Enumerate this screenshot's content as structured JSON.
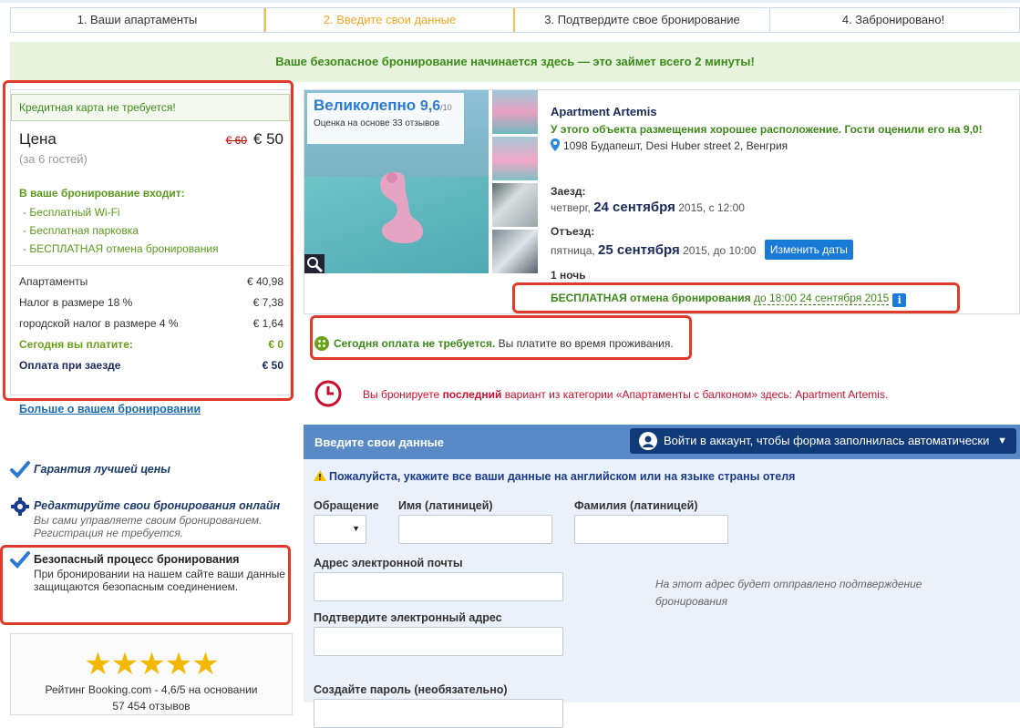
{
  "steps": [
    {
      "label": "1. Ваши апартаменты"
    },
    {
      "label": "2. Введите свои данные"
    },
    {
      "label": "3. Подтвердите свое бронирование"
    },
    {
      "label": "4. Забронировано!"
    }
  ],
  "banner": "Ваше безопасное бронирование начинается здесь — это займет всего 2 минуты!",
  "price_box": {
    "no_card": "Кредитная карта не требуется!",
    "price_label": "Цена",
    "old_price": "€ 60",
    "new_price": "€ 50",
    "guests": "(за 6 гостей)",
    "included_title": "В ваше бронирование входит:",
    "included": [
      "- Бесплатный Wi-Fi",
      "- Бесплатная парковка",
      "- БЕСПЛАТНАЯ отмена бронирования"
    ],
    "breakdown": [
      {
        "label": "Апартаменты",
        "value": "€ 40,98"
      },
      {
        "label": "Налог в размере 18 %",
        "value": "€ 7,38"
      },
      {
        "label": "городской налог в размере 4 %",
        "value": "€ 1,64"
      }
    ],
    "today_label": "Сегодня вы платите:",
    "today_value": "€ 0",
    "arrival_label": "Оплата при заезде",
    "arrival_value": "€ 50"
  },
  "more_link": "Больше о вашем бронировании",
  "perks": [
    {
      "title": "Гарантия лучшей цены",
      "desc": ""
    },
    {
      "title": "Редактируйте свои бронирования онлайн",
      "desc": "Вы сами управляете своим бронированием. Регистрация не требуется."
    },
    {
      "title": "Безопасный процесс бронирования",
      "desc": "При бронировании на нашем сайте ваши данные защищаются безопасным соединением."
    }
  ],
  "rating": {
    "stars": "★★★★★",
    "text_line1": "Рейтинг Booking.com - 4,6/5 на основании",
    "text_line2": "57 454 отзывов"
  },
  "hotel": {
    "score_word": "Великолепно",
    "score": "9,6",
    "score_of": "/10",
    "score_sub": "Оценка на основе 33 отзывов",
    "name": "Apartment Artemis",
    "desc": "У этого объекта размещения хорошее расположение. Гости оценили его на 9,0!",
    "address": "1098 Будапешт, Desi Huber street 2, Венгрия",
    "checkin_label": "Заезд:",
    "checkin_day": "четверг,",
    "checkin_date": "24 сентября",
    "checkin_rest": "2015, с 12:00",
    "checkout_label": "Отъезд:",
    "checkout_day": "пятница,",
    "checkout_date": "25 сентября",
    "checkout_rest": "2015, до 10:00",
    "change_dates": "Изменить даты",
    "nights": "1 ночь",
    "free_cancel_strong": "БЕСПЛАТНАЯ отмена бронирования",
    "free_cancel_until": "до 18:00 24 сентября 2015",
    "info_icon": "i"
  },
  "no_pay": {
    "strong": "Сегодня оплата не требуется.",
    "rest": "Вы платите во время проживания."
  },
  "last_room": {
    "pre": "Вы бронируете ",
    "strong": "последний",
    "post": " вариант из категории «Апартаменты с балконом» здесь: Apartment Artemis."
  },
  "form": {
    "title": "Введите свои данные",
    "login": "Войти в аккаунт, чтобы форма заполнилась автоматически",
    "caret": "▼",
    "warning": "Пожалуйста, укажите все ваши данные на английском или на языке страны отеля",
    "salutation_label": "Обращение",
    "salutation_arrow": "▼",
    "first_name_label": "Имя (латиницей)",
    "last_name_label": "Фамилия (латиницей)",
    "email_label": "Адрес электронной почты",
    "email_hint": "На этот адрес будет отправлено подтверждение бронирования",
    "confirm_email_label": "Подтвердите электронный адрес",
    "password_label": "Создайте пароль (необязательно)"
  },
  "colors": {
    "accent": "#1a7ad8",
    "success": "#3c8a1a",
    "annotation": "#e03a2a",
    "form_header": "#5a8ac6"
  }
}
